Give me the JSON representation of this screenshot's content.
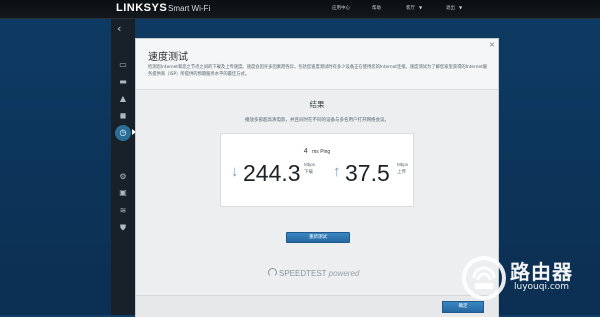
{
  "header": {
    "brand": "LINKSYS",
    "product": "Smart Wi-Fi",
    "nav": [
      "应用中心",
      "帮助",
      "客厅",
      "退出"
    ]
  },
  "sidebar": {
    "icons": [
      "back-chevron-icon",
      "devices-icon",
      "router-icon",
      "alert-icon",
      "speed-test-icon",
      "connectivity-icon",
      "wifi-settings-icon",
      "media-icon",
      "wireless-icon",
      "security-icon"
    ],
    "active": "speed-test-icon"
  },
  "modal": {
    "title": "速度测试",
    "description": "检测您Internet和您之节点之间的下载及上传速度。速度会因许多因素而各异，包括您速度测试时有多少设备正在使用您的Internet连接。速度测试为了解您家里获得的Internet服务提供商（ISP）所提供的预期服务水平的最佳方式。",
    "results_title": "结果",
    "results_subtitle": "播放多部超高清电影，并且同时在不同的设备与多名用户打开网络会议。",
    "ping_value": "4",
    "ping_unit": "ms Ping",
    "download": {
      "value": "244.3",
      "unit": "Mbps",
      "label": "下载"
    },
    "upload": {
      "value": "37.5",
      "unit": "Mbps",
      "label": "上传"
    },
    "retest_label": "重新测试",
    "powered_brand": "SPEEDTEST",
    "powered_word": "powered",
    "ok_label": "确定",
    "close_symbol": "×"
  },
  "watermark": {
    "text": "路由器",
    "url": "luyouqi.com"
  }
}
